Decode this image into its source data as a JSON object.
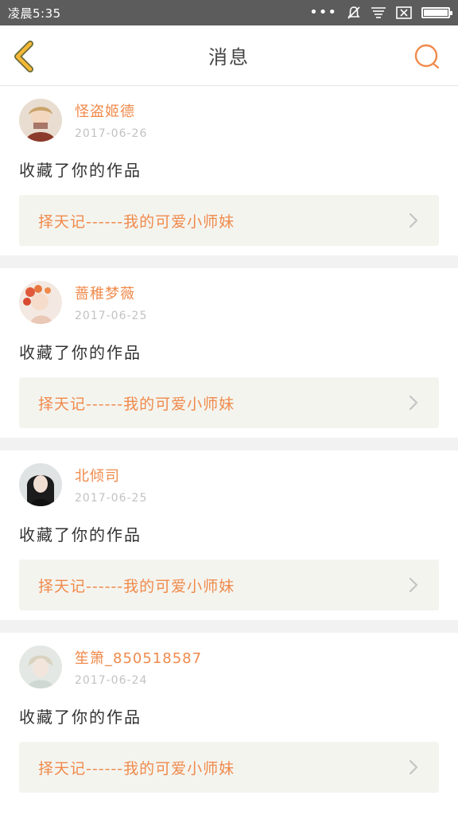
{
  "status_bar": {
    "time": "凌晨5:35",
    "icons": [
      "more-dots-icon",
      "mute-bell-icon",
      "notification-list-icon",
      "sim-close-icon",
      "battery-icon"
    ]
  },
  "header": {
    "title": "消息",
    "back_icon": "chevron-left-icon",
    "search_icon": "search-icon",
    "accent_color": "#f5b935",
    "search_color": "#f08a4b"
  },
  "messages": [
    {
      "username": "怪盗姬德",
      "date": "2017-06-26",
      "action": "收藏了你的作品",
      "work_title": "择天记------我的可爱小师妹"
    },
    {
      "username": "蔷稚梦薇",
      "date": "2017-06-25",
      "action": "收藏了你的作品",
      "work_title": "择天记------我的可爱小师妹"
    },
    {
      "username": "北倾司",
      "date": "2017-06-25",
      "action": "收藏了你的作品",
      "work_title": "择天记------我的可爱小师妹"
    },
    {
      "username": "笙箫_850518587",
      "date": "2017-06-24",
      "action": "收藏了你的作品",
      "work_title": "择天记------我的可爱小师妹"
    }
  ],
  "colors": {
    "username": "#f08a4b",
    "date": "#c2c2c2",
    "link_bg": "#f4f4ef",
    "divider": "#f2f2f2"
  }
}
